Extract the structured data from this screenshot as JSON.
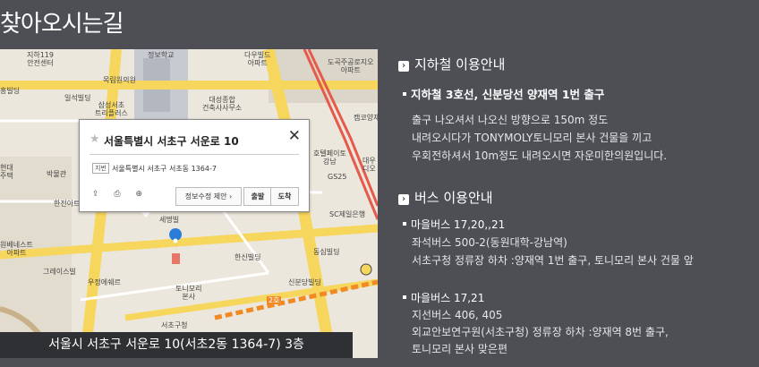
{
  "page": {
    "title": "찾아오시는길"
  },
  "map": {
    "labels": [
      "지하119\n안전센터",
      "정보학교",
      "다우빌드\n아파트",
      "도곡주공로지오\n아파트",
      "흥빌딩",
      "일석빌딩",
      "목림원의원",
      "삼성서초\n트리플러스",
      "대성종합\n건축사사무소",
      "캠코양재",
      "박물관",
      "현대\n주택",
      "한전아트",
      "호텔페이토\n강남",
      "GS25",
      "대우\n디오",
      "세명빌",
      "한신빌딩",
      "SC제일은행",
      "동심빌딩",
      "원베네스트\n아파트",
      "그레이스빌",
      "우정에쉐르",
      "신분당빌딩",
      "토니모리\n본사",
      "서초구청"
    ],
    "subway_badge": "2호",
    "popup": {
      "title": "서울특별시 서초구 서운로 10",
      "jibun_tag": "지번",
      "jibun_address": "서울특별시 서초구 서초동 1364-7",
      "edit_label": "정보수정 제안 ›",
      "depart_label": "출발",
      "arrive_label": "도착",
      "close_icon": "close-icon",
      "tools": [
        "share-icon",
        "print-icon",
        "zoom-icon"
      ]
    },
    "address": "서울시 서초구 서운로 10(서초2동 1364-7) 3층"
  },
  "subway": {
    "heading": "지하철 이용안내",
    "item": "지하철 3호선, 신분당선 양재역 1번 출구",
    "lines": [
      "출구 나오셔서 나오신 방향으로 150m 정도",
      "내려오시다가 TONYMOLY토니모리 본사 건물을 끼고",
      "우회전하셔서 10m정도 내려오시면 자운미한의원입니다."
    ]
  },
  "bus": {
    "heading": "버스 이용안내",
    "groups": [
      {
        "item": "마을버스 17,20,,21",
        "lines": [
          "좌석버스 500-2(동원대학-강남역)",
          "서초구청 정류장 하차 :양재역 1번 출구, 토니모리 본사 건물 앞"
        ]
      },
      {
        "item": "마을버스 17,21",
        "lines": [
          "지선버스 406, 405",
          "외교안보연구원(서초구청) 정류장 하차 :양재역 8번 출구,",
          "토니모리 본사 맞은편"
        ]
      }
    ]
  },
  "colors": {
    "background": "#4d4f55",
    "road_major": "#f6d65c",
    "road_red": "#e55a4a",
    "subway_line": "#f08a24",
    "pin": "#2b7bd8"
  }
}
